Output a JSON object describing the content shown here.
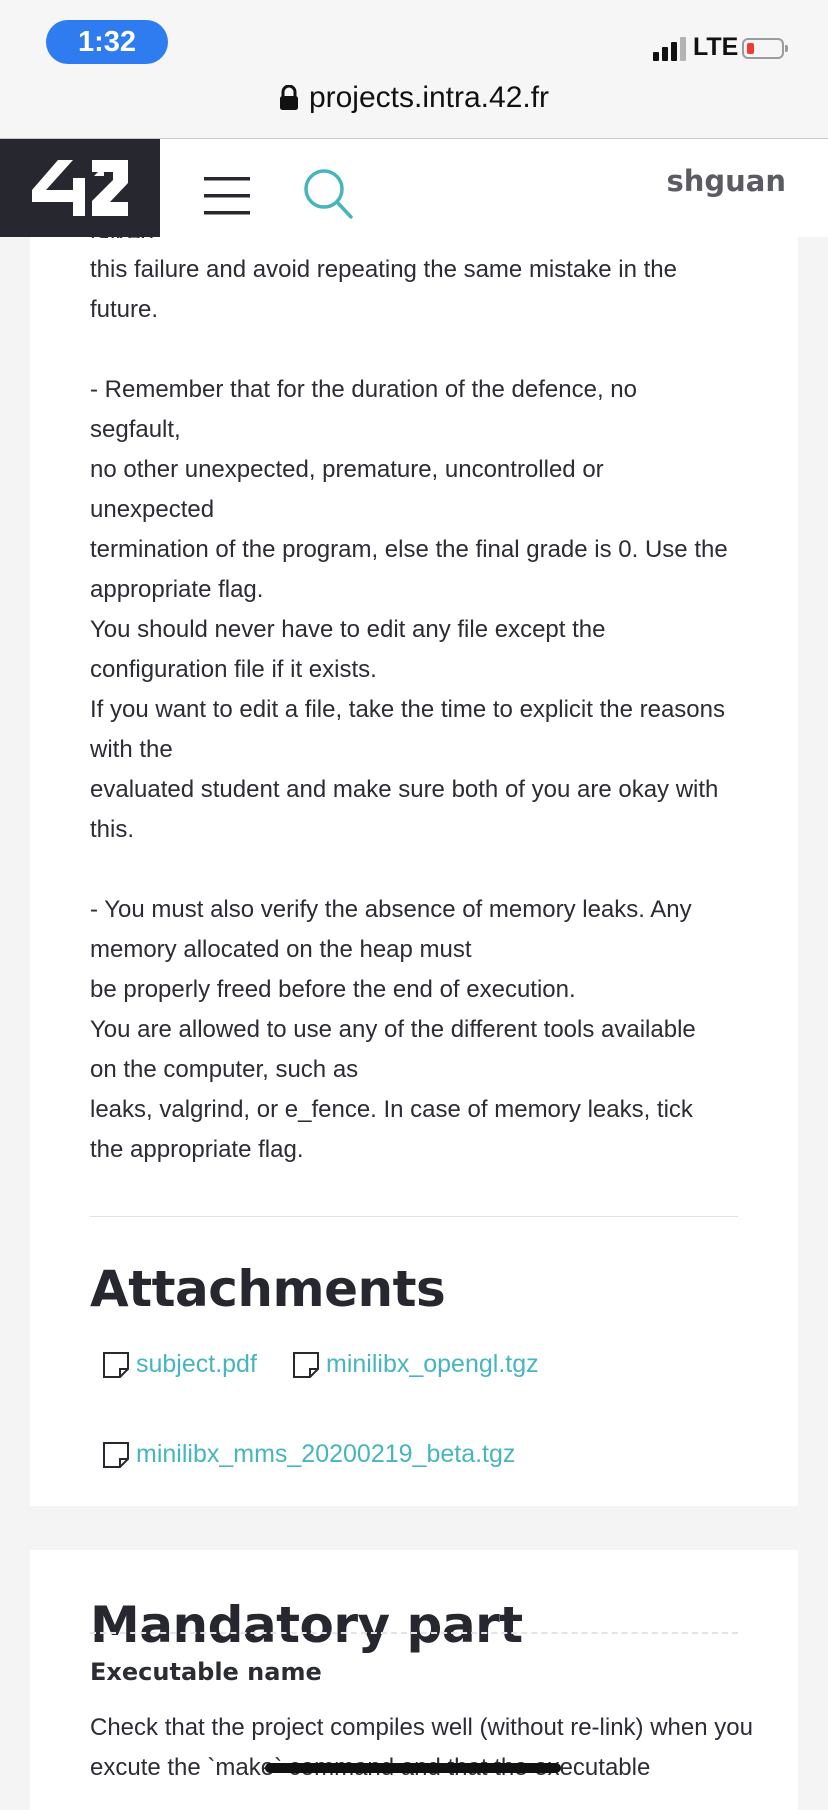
{
  "status_bar": {
    "time": "1:32",
    "network": "LTE",
    "battery_level": 0.1,
    "signal_bars_filled": 3,
    "signal_bars_total": 4
  },
  "browser": {
    "url": "projects.intra.42.fr",
    "lock_icon": "lock-icon"
  },
  "header": {
    "logo": "42",
    "menu_icon": "hamburger-icon",
    "search_icon": "search-icon",
    "username": "shguan",
    "accent_color": "#47b5bd",
    "dark_color": "#26272f"
  },
  "evaluation": {
    "cut_line": "talked",
    "text": "this failure and avoid repeating the same mistake in the\nfuture.\n\n- Remember that for the duration of the defence, no\nsegfault,\nno other unexpected, premature, uncontrolled or\nunexpected\ntermination of the program, else the final grade is 0. Use the\nappropriate flag.\nYou should never have to edit any file except the\nconfiguration file if it exists.\nIf you want to edit a file, take the time to explicit the reasons\nwith the\nevaluated student and make sure both of you are okay with\nthis.\n\n- You must also verify the absence of memory leaks. Any\nmemory allocated on the heap must\nbe properly freed before the end of execution.\nYou are allowed to use any of the different tools available\non the computer, such as\nleaks, valgrind, or e_fence. In case of memory leaks, tick\nthe appropriate flag."
  },
  "attachments": {
    "title": "Attachments",
    "files": [
      {
        "name": "subject.pdf",
        "icon": "file-icon"
      },
      {
        "name": "minilibx_opengl.tgz",
        "icon": "file-icon"
      },
      {
        "name": "minilibx_mms_20200219_beta.tgz",
        "icon": "file-icon"
      }
    ]
  },
  "mandatory": {
    "title": "Mandatory part",
    "executable_label": "Executable name",
    "executable_text": "Check that the project compiles well (without re-link) when you excute the `make` command and that the executable"
  }
}
